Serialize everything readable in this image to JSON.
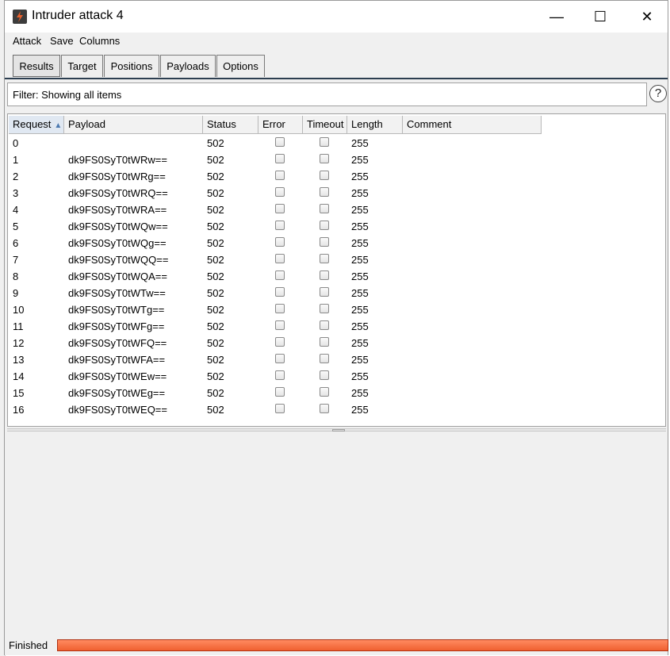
{
  "window": {
    "title": "Intruder attack 4"
  },
  "menu": [
    "Attack",
    "Save",
    "Columns"
  ],
  "tabs": [
    "Results",
    "Target",
    "Positions",
    "Payloads",
    "Options"
  ],
  "filter": {
    "text": "Filter: Showing all items"
  },
  "help": {
    "glyph": "?"
  },
  "columns": [
    "Request",
    "Payload",
    "Status",
    "Error",
    "Timeout",
    "Length",
    "Comment"
  ],
  "sort_arrow": "▲",
  "rows": [
    {
      "request": "0",
      "payload": "",
      "status": "502",
      "length": "255"
    },
    {
      "request": "1",
      "payload": "dk9FS0SyT0tWRw==",
      "status": "502",
      "length": "255"
    },
    {
      "request": "2",
      "payload": "dk9FS0SyT0tWRg==",
      "status": "502",
      "length": "255"
    },
    {
      "request": "3",
      "payload": "dk9FS0SyT0tWRQ==",
      "status": "502",
      "length": "255"
    },
    {
      "request": "4",
      "payload": "dk9FS0SyT0tWRA==",
      "status": "502",
      "length": "255"
    },
    {
      "request": "5",
      "payload": "dk9FS0SyT0tWQw==",
      "status": "502",
      "length": "255"
    },
    {
      "request": "6",
      "payload": "dk9FS0SyT0tWQg==",
      "status": "502",
      "length": "255"
    },
    {
      "request": "7",
      "payload": "dk9FS0SyT0tWQQ==",
      "status": "502",
      "length": "255"
    },
    {
      "request": "8",
      "payload": "dk9FS0SyT0tWQA==",
      "status": "502",
      "length": "255"
    },
    {
      "request": "9",
      "payload": "dk9FS0SyT0tWTw==",
      "status": "502",
      "length": "255"
    },
    {
      "request": "10",
      "payload": "dk9FS0SyT0tWTg==",
      "status": "502",
      "length": "255"
    },
    {
      "request": "11",
      "payload": "dk9FS0SyT0tWFg==",
      "status": "502",
      "length": "255"
    },
    {
      "request": "12",
      "payload": "dk9FS0SyT0tWFQ==",
      "status": "502",
      "length": "255"
    },
    {
      "request": "13",
      "payload": "dk9FS0SyT0tWFA==",
      "status": "502",
      "length": "255"
    },
    {
      "request": "14",
      "payload": "dk9FS0SyT0tWEw==",
      "status": "502",
      "length": "255"
    },
    {
      "request": "15",
      "payload": "dk9FS0SyT0tWEg==",
      "status": "502",
      "length": "255"
    },
    {
      "request": "16",
      "payload": "dk9FS0SyT0tWEQ==",
      "status": "502",
      "length": "255"
    }
  ],
  "status": {
    "text": "Finished",
    "progress_fraction": 1.0
  },
  "colors": {
    "progress": "#f06030",
    "app_icon_bg": "#3c3c3c",
    "app_icon_accent": "#e8602c"
  }
}
